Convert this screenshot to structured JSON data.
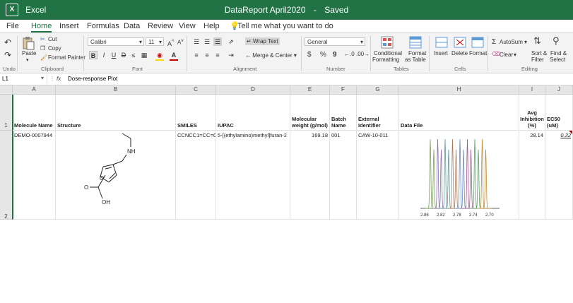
{
  "titlebar": {
    "app_name": "Excel",
    "doc_title": "DataReport April2020",
    "separator": "-",
    "save_status": "Saved",
    "logo_letter": "X"
  },
  "menu": {
    "tabs": [
      "File",
      "Home",
      "Insert",
      "Formulas",
      "Data",
      "Review",
      "View",
      "Help"
    ],
    "active": "Home",
    "tell_me": "Tell me what you want to do"
  },
  "ribbon": {
    "undo": {
      "label": "Undo"
    },
    "clipboard": {
      "paste": "Paste",
      "cut": "Cut",
      "copy": "Copy",
      "format_painter": "Format Painter",
      "group": "Clipboard"
    },
    "font": {
      "name": "Calibri",
      "size": "11",
      "bold": "B",
      "italic": "I",
      "underline": "U",
      "strike": "D",
      "group": "Font"
    },
    "alignment": {
      "wrap": "Wrap Text",
      "merge": "Merge & Center",
      "group": "Alignment"
    },
    "number": {
      "format": "General",
      "currency": "$",
      "percent": "%",
      "comma": "9",
      "group": "Number"
    },
    "styles": {
      "conditional": "Conditional",
      "conditional2": "Formatting",
      "format_table": "Format",
      "format_table2": "as Table",
      "group": "Tables"
    },
    "cells": {
      "insert": "Insert",
      "delete": "Delete",
      "format": "Format",
      "group": "Cells"
    },
    "editing": {
      "autosum": "AutoSum",
      "clear": "Clear",
      "sort": "Sort &",
      "sort2": "Filter",
      "find": "Find &",
      "find2": "Select",
      "group": "Editing"
    }
  },
  "formula_bar": {
    "name_box": "L1",
    "fx": "fx",
    "content": "Dose-response Plot"
  },
  "columns": [
    "A",
    "B",
    "C",
    "D",
    "E",
    "F",
    "G",
    "H",
    "I",
    "J"
  ],
  "rows": [
    "1",
    "2"
  ],
  "header_row": {
    "A": "Molecule Name",
    "B": "Structure",
    "C": "SMILES",
    "D": "IUPAC",
    "E": "Molecular weight (g/mol)",
    "F": "Batch Name",
    "G": "External Identifier",
    "H": "Data File",
    "I": "Avg Inhibition (%)",
    "J": "EC50 (uM)"
  },
  "data_row": {
    "A": "DEMO-0007944",
    "C": "CCNCC1=CC=C(O",
    "D": "5-[(ethylamino)methyl]furan-2",
    "E": "169.18",
    "F": "001",
    "G": "CAW-10-011",
    "I": "28.14",
    "J": "0.32"
  },
  "structure": {
    "atom_n": "NH",
    "atom_o_ring": "O",
    "atom_o_acid": "O",
    "atom_oh": "OH"
  },
  "spectrum": {
    "x_ticks": [
      "2.86",
      "2.82",
      "2.78",
      "2.74",
      "2.70"
    ]
  }
}
